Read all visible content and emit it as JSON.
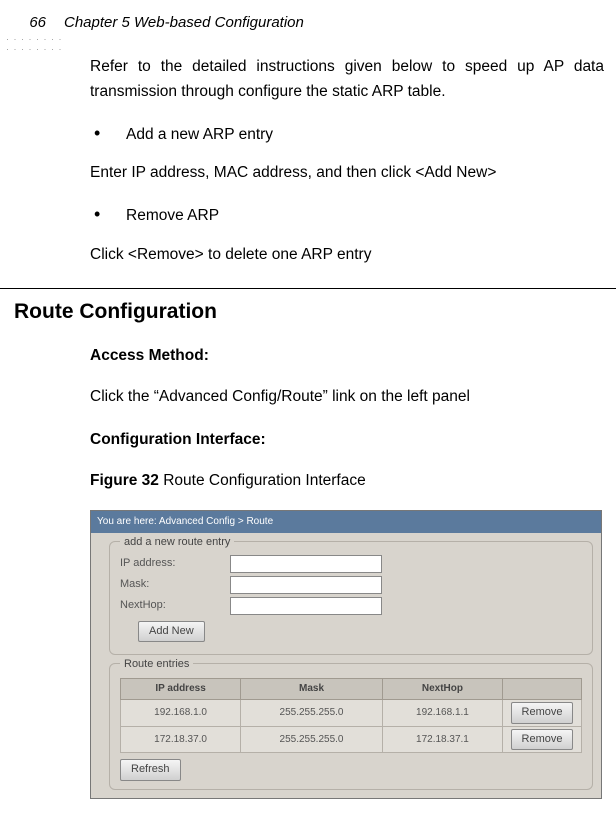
{
  "header": {
    "page_number": "66",
    "chapter_title": "Chapter 5 Web-based Configuration"
  },
  "intro": "Refer to the detailed instructions given below to speed up AP data transmission through configure the static ARP table.",
  "bullet1": "Add a new ARP entry",
  "line1": "Enter IP address, MAC address, and then click <Add New>",
  "bullet2": "Remove ARP",
  "line2": "Click <Remove> to delete one ARP entry",
  "section_title": "Route Configuration",
  "access_method_label": "Access Method:",
  "access_method_text": "Click the “Advanced Config/Route” link on the left panel",
  "config_iface_label": "Configuration Interface:",
  "figure_caption_bold": "Figure 32",
  "figure_caption_rest": " Route Configuration Interface",
  "ss": {
    "breadcrumb": "You are here: Advanced Config > Route",
    "fs1_legend": "add a new route entry",
    "ip_label": "IP address:",
    "mask_label": "Mask:",
    "hop_label": "NextHop:",
    "add_btn": "Add New",
    "fs2_legend": "Route entries",
    "cols": {
      "c1": "IP address",
      "c2": "Mask",
      "c3": "NextHop"
    },
    "rows": [
      {
        "ip": "192.168.1.0",
        "mask": "255.255.255.0",
        "hop": "192.168.1.1",
        "act": "Remove"
      },
      {
        "ip": "172.18.37.0",
        "mask": "255.255.255.0",
        "hop": "172.18.37.1",
        "act": "Remove"
      }
    ],
    "refresh_btn": "Refresh"
  }
}
